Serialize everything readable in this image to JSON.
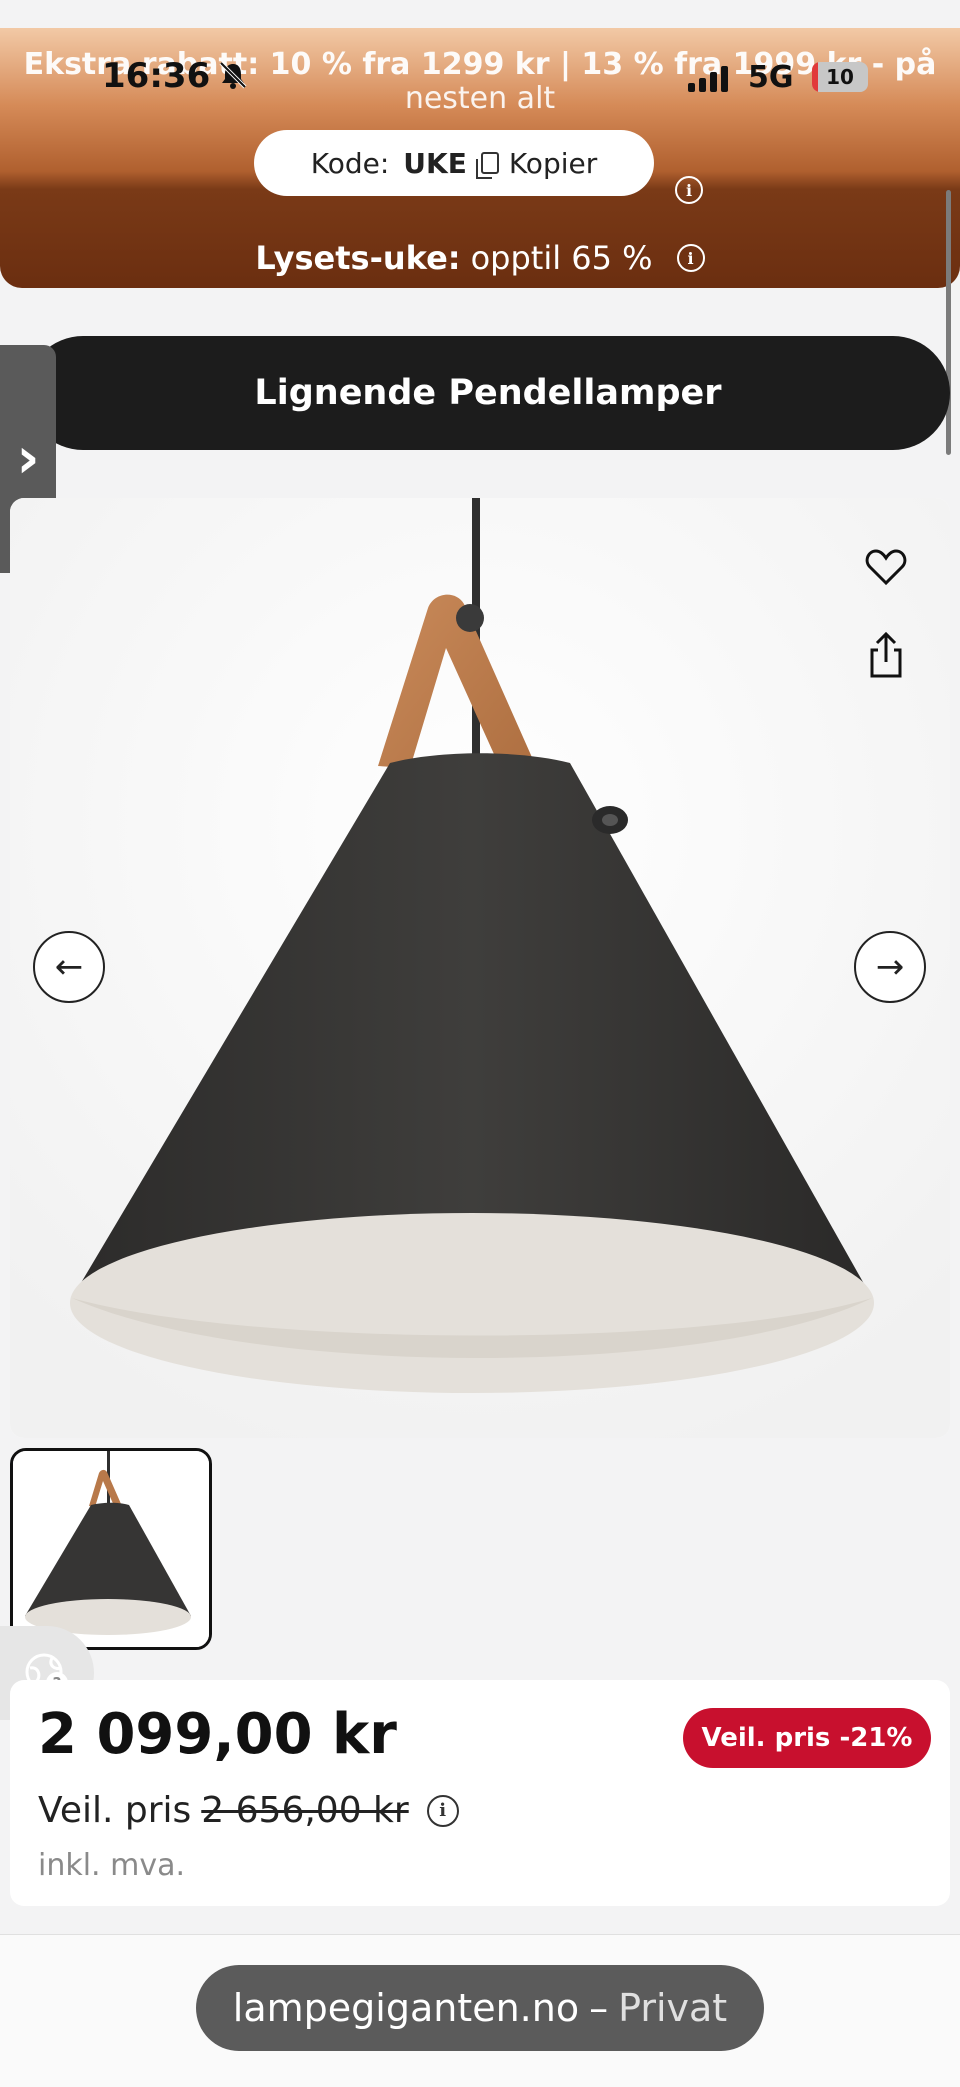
{
  "status_bar": {
    "time": "16:36",
    "network": "5G",
    "battery": "10",
    "battery_fraction": 0.1
  },
  "promo": {
    "headline": "Ekstra rabatt: 10 % fra 1299 kr | 13 % fra 1999 kr - på",
    "headline_cont": "nesten alt",
    "code_label": "Kode:",
    "code_value": "UKE",
    "copy_label": "Kopier",
    "week_title": "Lysets-uke:",
    "week_text": "opptil 65 %"
  },
  "category_button": {
    "label": "Lignende Pendellamper"
  },
  "product": {
    "price": "2 099,00 kr",
    "discount_badge": "Veil. pris -21%",
    "rrp_label": "Veil. pris",
    "rrp_value": "2 656,00 kr",
    "vat_text": "inkl. mva."
  },
  "browser": {
    "domain": "lampegiganten.no",
    "separator": "–",
    "mode": "Privat"
  },
  "colors": {
    "accent_red": "#c8102e",
    "dark": "#1c1c1c",
    "promo_brown": "#6b2e10"
  }
}
